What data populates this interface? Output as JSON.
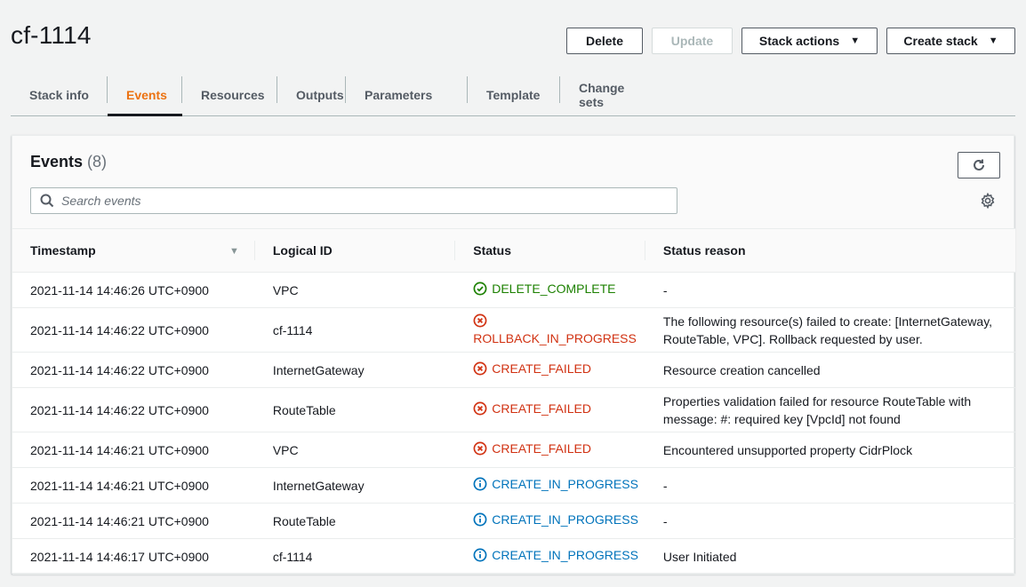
{
  "page": {
    "title": "cf-1114"
  },
  "header_buttons": {
    "delete": "Delete",
    "update": "Update",
    "stack_actions": "Stack actions",
    "create_stack": "Create stack"
  },
  "tabs": [
    {
      "label": "Stack info",
      "active": false
    },
    {
      "label": "Events",
      "active": true
    },
    {
      "label": "Resources",
      "active": false
    },
    {
      "label": "Outputs",
      "active": false
    },
    {
      "label": "Parameters",
      "active": false
    },
    {
      "label": "Template",
      "active": false
    },
    {
      "label": "Change sets",
      "active": false
    }
  ],
  "events_panel": {
    "title": "Events",
    "count": "(8)",
    "search_placeholder": "Search events"
  },
  "table": {
    "columns": [
      "Timestamp",
      "Logical ID",
      "Status",
      "Status reason"
    ],
    "rows": [
      {
        "timestamp": "2021-11-14 14:46:26 UTC+0900",
        "logical_id": "VPC",
        "status": "DELETE_COMPLETE",
        "status_type": "success",
        "reason": "-"
      },
      {
        "timestamp": "2021-11-14 14:46:22 UTC+0900",
        "logical_id": "cf-1114",
        "status": "ROLLBACK_IN_PROGRESS",
        "status_type": "error",
        "reason": "The following resource(s) failed to create: [InternetGateway, RouteTable, VPC]. Rollback requested by user."
      },
      {
        "timestamp": "2021-11-14 14:46:22 UTC+0900",
        "logical_id": "InternetGateway",
        "status": "CREATE_FAILED",
        "status_type": "error",
        "reason": "Resource creation cancelled"
      },
      {
        "timestamp": "2021-11-14 14:46:22 UTC+0900",
        "logical_id": "RouteTable",
        "status": "CREATE_FAILED",
        "status_type": "error",
        "reason": "Properties validation failed for resource RouteTable with message: #: required key [VpcId] not found"
      },
      {
        "timestamp": "2021-11-14 14:46:21 UTC+0900",
        "logical_id": "VPC",
        "status": "CREATE_FAILED",
        "status_type": "error",
        "reason": "Encountered unsupported property CidrPlock"
      },
      {
        "timestamp": "2021-11-14 14:46:21 UTC+0900",
        "logical_id": "InternetGateway",
        "status": "CREATE_IN_PROGRESS",
        "status_type": "info",
        "reason": "-"
      },
      {
        "timestamp": "2021-11-14 14:46:21 UTC+0900",
        "logical_id": "RouteTable",
        "status": "CREATE_IN_PROGRESS",
        "status_type": "info",
        "reason": "-"
      },
      {
        "timestamp": "2021-11-14 14:46:17 UTC+0900",
        "logical_id": "cf-1114",
        "status": "CREATE_IN_PROGRESS",
        "status_type": "info",
        "reason": "User Initiated"
      }
    ]
  },
  "icons": {
    "success": "check-circle-icon",
    "error": "x-circle-icon",
    "info": "info-circle-icon",
    "refresh": "refresh-icon",
    "search": "search-icon",
    "settings": "gear-icon"
  },
  "colors": {
    "active_tab": "#ec7211",
    "success": "#1d8102",
    "error": "#d13212",
    "info": "#0073bb"
  }
}
